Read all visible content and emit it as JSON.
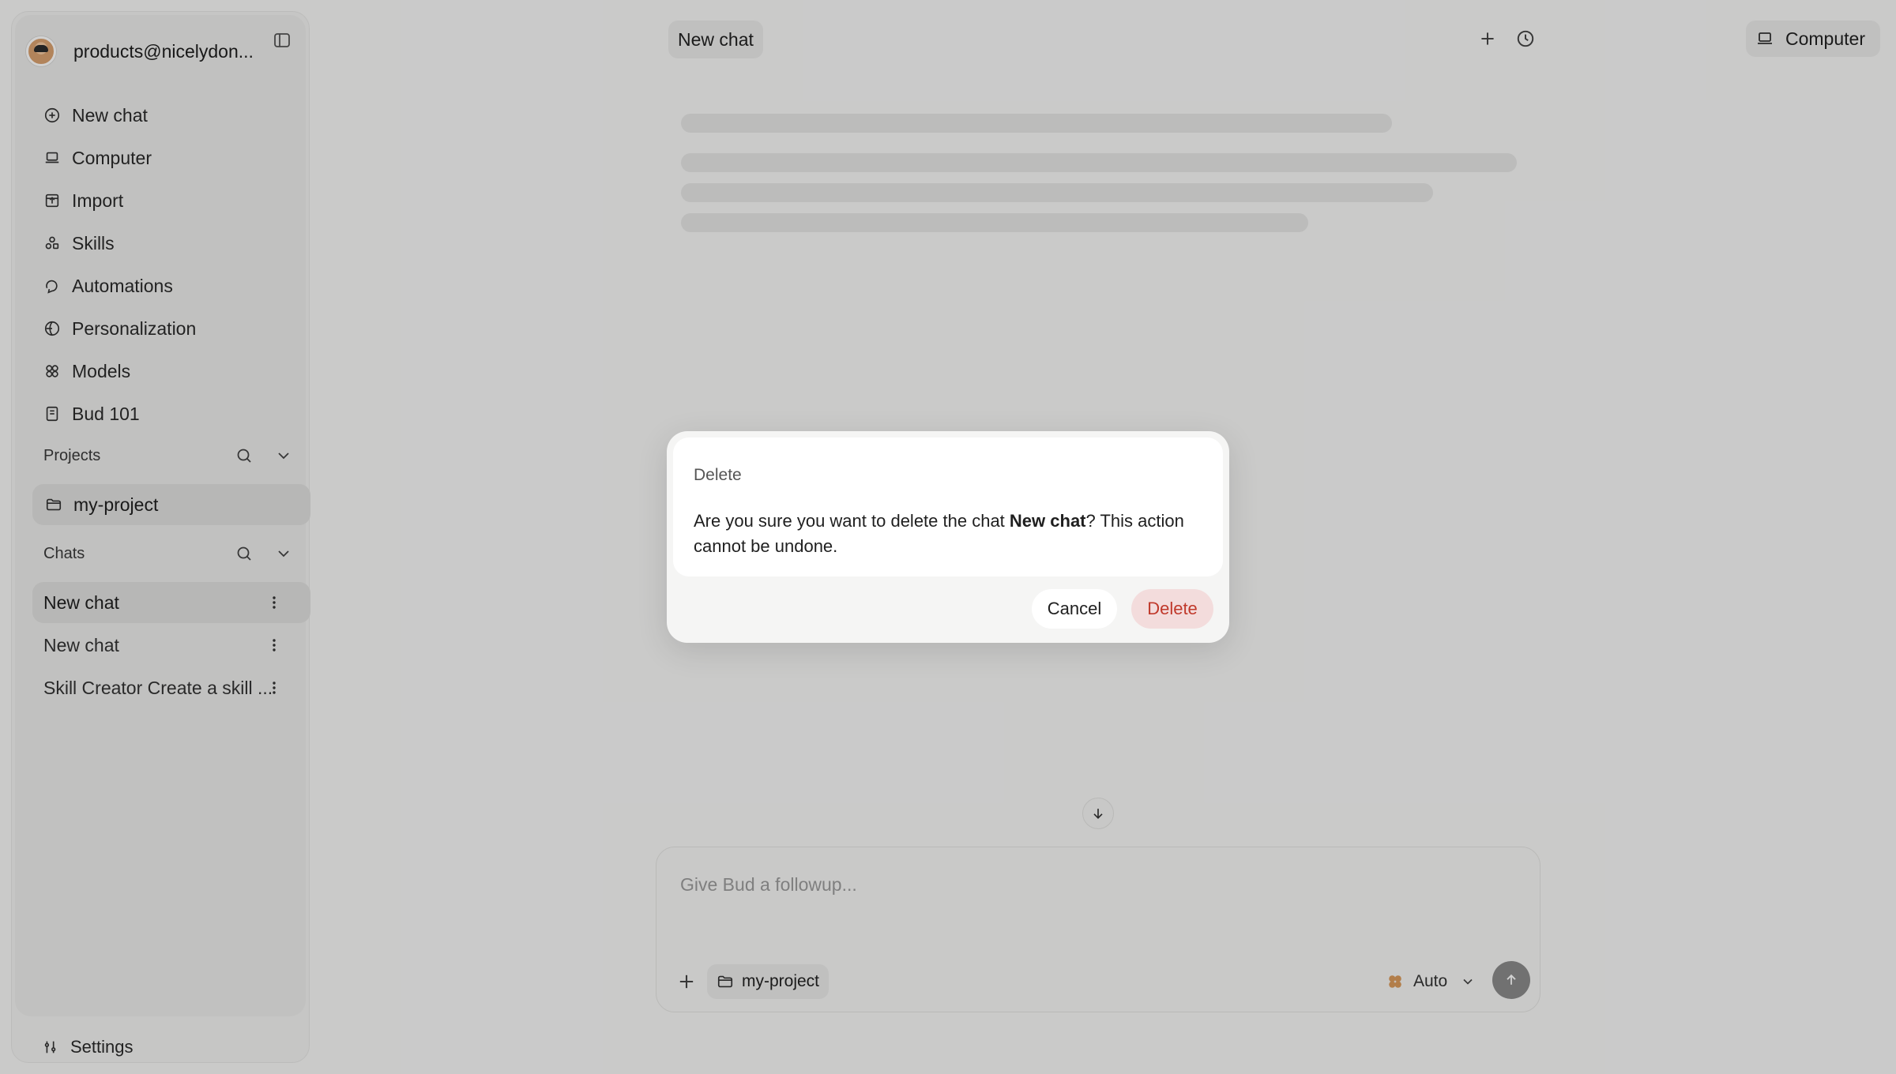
{
  "account": {
    "email": "products@nicelydon..."
  },
  "nav": {
    "items": [
      {
        "label": "New chat",
        "icon": "plus-circle-icon"
      },
      {
        "label": "Computer",
        "icon": "laptop-icon"
      },
      {
        "label": "Import",
        "icon": "import-icon"
      },
      {
        "label": "Skills",
        "icon": "skills-icon"
      },
      {
        "label": "Automations",
        "icon": "automations-icon"
      },
      {
        "label": "Personalization",
        "icon": "personalization-icon"
      },
      {
        "label": "Models",
        "icon": "models-icon"
      },
      {
        "label": "Bud 101",
        "icon": "book-icon"
      }
    ]
  },
  "projects": {
    "heading": "Projects",
    "items": [
      {
        "label": "my-project"
      }
    ]
  },
  "chats": {
    "heading": "Chats",
    "items": [
      {
        "label": "New chat",
        "selected": true
      },
      {
        "label": "New chat",
        "selected": false
      },
      {
        "label": "Skill Creator Create a skill ...",
        "selected": false
      }
    ]
  },
  "settings": {
    "label": "Settings"
  },
  "topbar": {
    "title": "New chat",
    "computer_label": "Computer"
  },
  "composer": {
    "placeholder": "Give Bud a followup...",
    "project_chip": "my-project",
    "model": "Auto"
  },
  "dialog": {
    "title": "Delete",
    "message_prefix": "Are you sure you want to delete the chat ",
    "message_bold": "New chat",
    "message_suffix": "? This action cannot be undone.",
    "cancel_label": "Cancel",
    "delete_label": "Delete"
  },
  "colors": {
    "background": "#f7f7f6",
    "sidebar": "#ececeb",
    "selected_row": "#e0e0de",
    "delete_text": "#c0392b",
    "delete_bg": "#f3dcdc",
    "overlay": "rgba(0,0,0,0.18)"
  }
}
